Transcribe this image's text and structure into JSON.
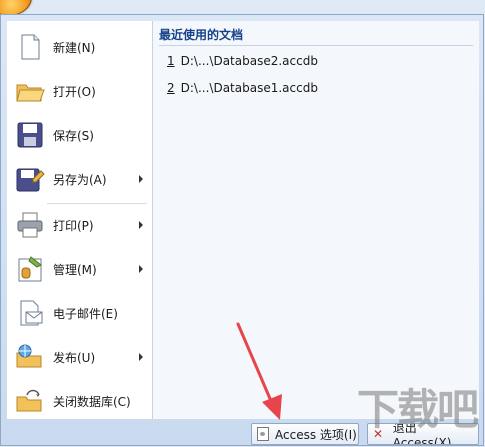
{
  "menu": {
    "items": [
      {
        "label": "新建(N)",
        "icon": "new-document-icon",
        "has_submenu": false
      },
      {
        "label": "打开(O)",
        "icon": "open-folder-icon",
        "has_submenu": false
      },
      {
        "label": "保存(S)",
        "icon": "save-disk-icon",
        "has_submenu": false
      },
      {
        "label": "另存为(A)",
        "icon": "save-as-icon",
        "has_submenu": true
      },
      {
        "label": "打印(P)",
        "icon": "printer-icon",
        "has_submenu": true
      },
      {
        "label": "管理(M)",
        "icon": "manage-icon",
        "has_submenu": true
      },
      {
        "label": "电子邮件(E)",
        "icon": "email-icon",
        "has_submenu": false
      },
      {
        "label": "发布(U)",
        "icon": "publish-icon",
        "has_submenu": true
      },
      {
        "label": "关闭数据库(C)",
        "icon": "close-database-icon",
        "has_submenu": false
      }
    ]
  },
  "recent": {
    "title": "最近使用的文档",
    "files": [
      {
        "num": "1",
        "path": "D:\\...\\Database2.accdb"
      },
      {
        "num": "2",
        "path": "D:\\...\\Database1.accdb"
      }
    ]
  },
  "bottom": {
    "options_label": "Access 选项(I)",
    "exit_label": "退出 Access(X)"
  },
  "watermark": {
    "text": "下载吧"
  },
  "colors": {
    "accent": "#15428b",
    "annotation_arrow": "#e8444c"
  }
}
